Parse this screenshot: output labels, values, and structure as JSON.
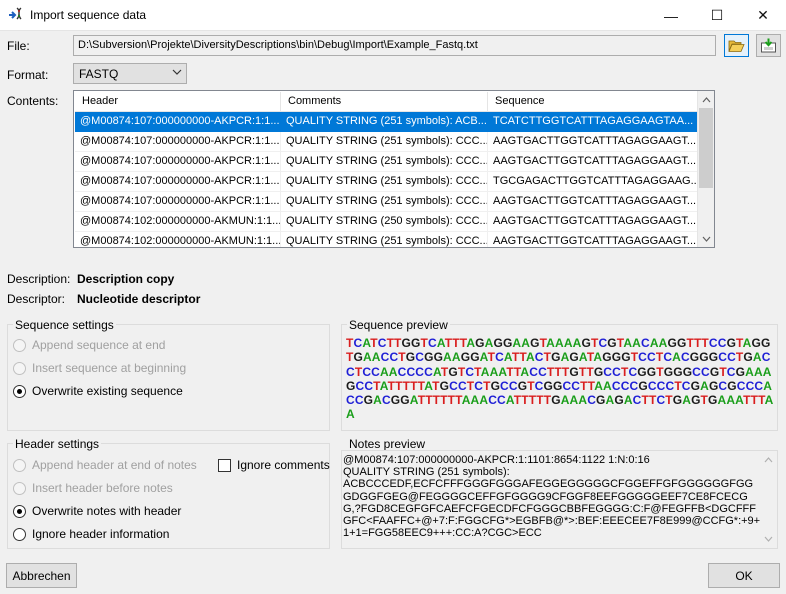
{
  "window": {
    "title": "Import sequence data",
    "controls": {
      "minimize": "—",
      "maximize": "☐",
      "close": "✕"
    }
  },
  "file": {
    "label": "File:",
    "path": "D:\\Subversion\\Projekte\\DiversityDescriptions\\bin\\Debug\\Import\\Example_Fastq.txt",
    "open_icon": "folder-open-icon",
    "save_icon": "save-download-icon"
  },
  "format": {
    "label": "Format:",
    "value": "FASTQ"
  },
  "contents": {
    "label": "Contents:",
    "columns": [
      "Header",
      "Comments",
      "Sequence"
    ],
    "rows": [
      [
        "@M00874:107:000000000-AKPCR:1:1...",
        "QUALITY STRING (251 symbols): ACB...",
        "TCATCTTGGTCATTTAGAGGAAGTAA..."
      ],
      [
        "@M00874:107:000000000-AKPCR:1:1...",
        "QUALITY STRING (251 symbols): CCC...",
        "AAGTGACTTGGTCATTTAGAGGAAGT..."
      ],
      [
        "@M00874:107:000000000-AKPCR:1:1...",
        "QUALITY STRING (251 symbols): CCC...",
        "AAGTGACTTGGTCATTTAGAGGAAGT..."
      ],
      [
        "@M00874:107:000000000-AKPCR:1:1...",
        "QUALITY STRING (251 symbols): CCC...",
        "TGCGAGACTTGGTCATTTAGAGGAAG..."
      ],
      [
        "@M00874:107:000000000-AKPCR:1:1...",
        "QUALITY STRING (251 symbols): CCC...",
        "AAGTGACTTGGTCATTTAGAGGAAGT..."
      ],
      [
        "@M00874:102:000000000-AKMUN:1:1...",
        "QUALITY STRING (250 symbols): CCC...",
        "AAGTGACTTGGTCATTTAGAGGAAGT..."
      ],
      [
        "@M00874:102:000000000-AKMUN:1:1...",
        "QUALITY STRING (251 symbols): CCC...",
        "AAGTGACTTGGTCATTTAGAGGAAGT..."
      ]
    ],
    "selected_row": 0
  },
  "description": {
    "label": "Description:",
    "value": "Description copy"
  },
  "descriptor": {
    "label": "Descriptor:",
    "value": "Nucleotide descriptor"
  },
  "sequence_settings": {
    "title": "Sequence settings",
    "options": [
      {
        "label": "Append sequence at end",
        "enabled": false,
        "checked": false
      },
      {
        "label": "Insert sequence at beginning",
        "enabled": false,
        "checked": false
      },
      {
        "label": "Overwrite existing sequence",
        "enabled": true,
        "checked": true
      }
    ]
  },
  "sequence_preview": {
    "title": "Sequence preview",
    "text": "TCATCTTGGTCATTTAGAGGAAGTAAAAGTCGTAACAAGGTTTCCGTAGGTGAACCTGCGGAAGGATCATTACTGAGATAGGGTCCTCACGGGCCTGACCTCCAACCCCATGTCTAAATTACCTTTGTTGCCTCGGTGGGCCGTCGAAAGCCTATTTTTATGCCTCTGCCGTCGGCCTTAACCCGCCCTCGAGCGCCCACCGACGGATTTTTTAAACCATTTTTGAAACGAGACTTCTGAGTGAAATTTAA",
    "colors": {
      "A": "#1a9e1a",
      "C": "#1f1fd6",
      "G": "#1a1a1a",
      "T": "#d91e1e"
    }
  },
  "header_settings": {
    "title": "Header settings",
    "options": [
      {
        "label": "Append header at end of notes",
        "enabled": false,
        "checked": false
      },
      {
        "label": "Insert header before notes",
        "enabled": false,
        "checked": false
      },
      {
        "label": "Overwrite notes with header",
        "enabled": true,
        "checked": true
      },
      {
        "label": "Ignore header information",
        "enabled": true,
        "checked": false
      }
    ],
    "ignore_comments": {
      "label": "Ignore comments",
      "checked": false
    }
  },
  "notes_preview": {
    "title": "Notes preview",
    "text": "@M00874:107:000000000-AKPCR:1:1101:8654:1122 1:N:0:16\nQUALITY STRING (251 symbols):\nACBCCCEDF,ECFCFFFGGGFGGGAFEGGEGGGGGCFGGEFFGFGGGGGGFGGGDGGFGEG@FEGGGGCEFFGFGGGG9CFGGF8EEFGGGGGEEF7CE8FCECGG,?FGD8CEGFGFCAEFCFGECDFCFGGGCBBFEGGGG:C:F@FEGFFB<DGCFFFGFC<FAAFFC+@+7:F:FGGCFG*>EGBFB@*>:BEF:EEECEE7F8E999@CCFG*:+9+1+1=FGG58EEC9+++:CC:A?CGC>ECC"
  },
  "buttons": {
    "cancel": "Abbrechen",
    "ok": "OK"
  }
}
